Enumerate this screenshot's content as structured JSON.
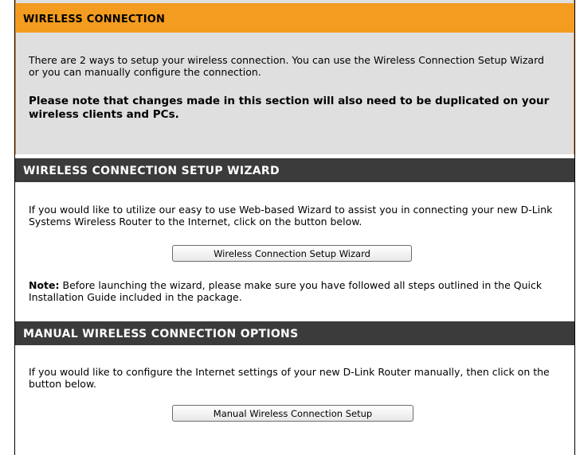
{
  "section_wireless": {
    "title": "WIRELESS CONNECTION",
    "intro": "There are 2 ways to setup your wireless connection. You can use the Wireless Connection Setup Wizard or you can manually configure the connection.",
    "note": "Please note that changes made in this section will also need to be duplicated on your wireless clients and PCs."
  },
  "section_wizard": {
    "title": "WIRELESS CONNECTION SETUP WIZARD",
    "desc": "If you would like to utilize our easy to use Web-based Wizard to assist you in connecting your new D-Link Systems Wireless Router to the Internet, click on the button below.",
    "button_label": "Wireless Connection Setup Wizard",
    "note_label": "Note:",
    "note_text": " Before launching the wizard, please make sure you have followed all steps outlined in the Quick Installation Guide included in the package."
  },
  "section_manual": {
    "title": "MANUAL WIRELESS CONNECTION OPTIONS",
    "desc": "If you would like to configure the Internet settings of your new D-Link Router manually, then click on the button below.",
    "button_label": "Manual Wireless Connection Setup"
  },
  "colors": {
    "orange_header": "#f39c1f",
    "orange_border": "#e98f3d",
    "gray_panel": "#dfdfdf",
    "dark_header": "#3b3b3b"
  }
}
